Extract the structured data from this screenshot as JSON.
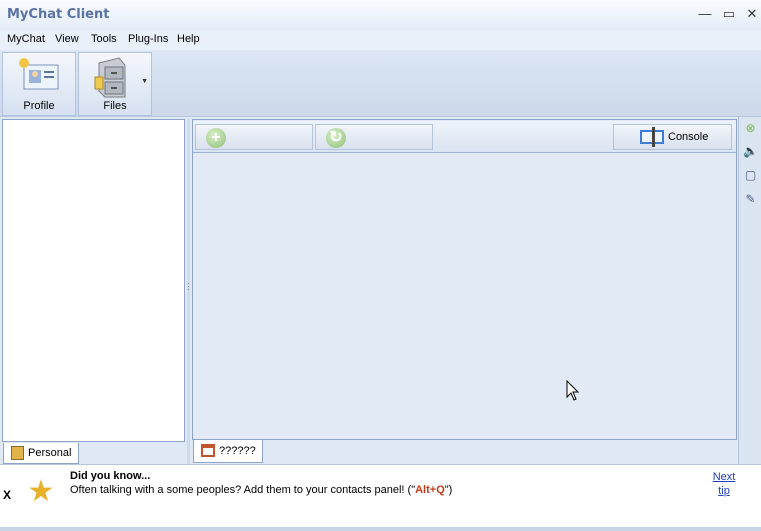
{
  "app": {
    "title": "MyChat Client"
  },
  "window_controls": {
    "minimize": "—",
    "maximize": "▭",
    "close": "✕"
  },
  "menu": [
    "MyChat",
    "View",
    "Tools",
    "Plug-Ins",
    "Help"
  ],
  "ribbon": {
    "profile_label": "Profile",
    "files_label": "Files"
  },
  "left_panel": {
    "tab_label": "Personal"
  },
  "toolbar": {
    "console_label": "Console"
  },
  "content_tab": {
    "label": "??????"
  },
  "tip": {
    "close": "X",
    "title": "Did you know...",
    "text_before": "Often talking with a some peoples? Add them to your contacts panel! (\"",
    "key": "Alt+Q",
    "text_after": "\")",
    "next_line1": "Next",
    "next_line2": "tip"
  },
  "side_icons": [
    "close-circle-icon",
    "speaker-icon",
    "window-icon",
    "pin-icon"
  ],
  "colors": {
    "title": "#5b73a3",
    "accent_key": "#c43a1a",
    "link": "#1f3fbf"
  }
}
